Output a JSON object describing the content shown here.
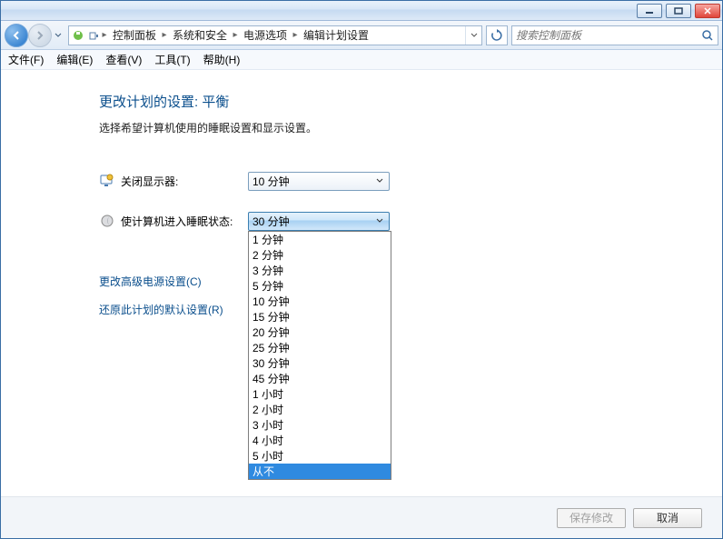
{
  "breadcrumb": {
    "seg0": "控制面板",
    "seg1": "系统和安全",
    "seg2": "电源选项",
    "seg3": "编辑计划设置"
  },
  "search": {
    "placeholder": "搜索控制面板"
  },
  "menu": {
    "file": "文件(F)",
    "edit": "编辑(E)",
    "view": "查看(V)",
    "tools": "工具(T)",
    "help": "帮助(H)"
  },
  "page": {
    "title": "更改计划的设置: 平衡",
    "subtitle": "选择希望计算机使用的睡眠设置和显示设置。",
    "display_off_label": "关闭显示器:",
    "display_off_value": "10 分钟",
    "sleep_label": "使计算机进入睡眠状态:",
    "sleep_value": "30 分钟",
    "adv_link": "更改高级电源设置(C)",
    "restore_link": "还原此计划的默认设置(R)"
  },
  "options": {
    "o0": "1 分钟",
    "o1": "2 分钟",
    "o2": "3 分钟",
    "o3": "5 分钟",
    "o4": "10 分钟",
    "o5": "15 分钟",
    "o6": "20 分钟",
    "o7": "25 分钟",
    "o8": "30 分钟",
    "o9": "45 分钟",
    "o10": "1 小时",
    "o11": "2 小时",
    "o12": "3 小时",
    "o13": "4 小时",
    "o14": "5 小时",
    "o15": "从不"
  },
  "footer": {
    "save": "保存修改",
    "cancel": "取消"
  }
}
